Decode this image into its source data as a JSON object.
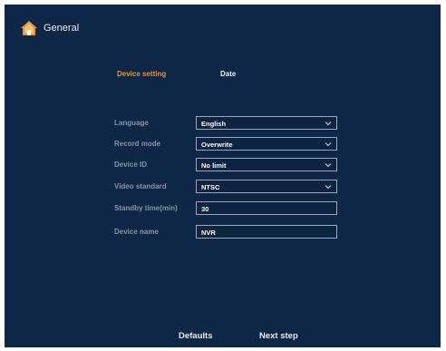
{
  "header": {
    "title": "General",
    "icon": "home-icon"
  },
  "tabs": [
    {
      "label": "Device setting",
      "active": true
    },
    {
      "label": "Date",
      "active": false
    }
  ],
  "form": {
    "fields": [
      {
        "label": "Language",
        "value": "English",
        "type": "select"
      },
      {
        "label": "Record mode",
        "value": "Overwrite",
        "type": "select"
      },
      {
        "label": "Device ID",
        "value": "No limit",
        "type": "select"
      },
      {
        "label": "Video standard",
        "value": "NTSC",
        "type": "select"
      },
      {
        "label": "Standby time(min)",
        "value": "30",
        "type": "input"
      },
      {
        "label": "Device name",
        "value": "NVR",
        "type": "input"
      }
    ]
  },
  "footer": {
    "defaults_label": "Defaults",
    "next_label": "Next step"
  },
  "colors": {
    "background": "#0f2747",
    "accent": "#e8952d",
    "label": "#8792a6",
    "field_border": "#9aa8bd"
  }
}
